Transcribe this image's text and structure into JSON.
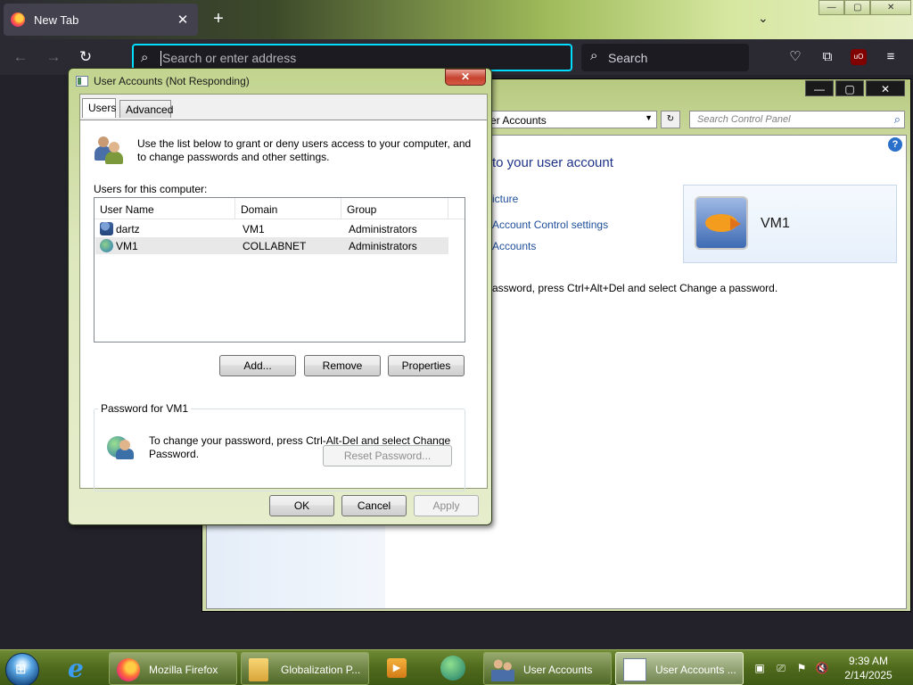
{
  "browser": {
    "tab_title": "New Tab",
    "tab_close": "✕",
    "new_tab": "+",
    "list_tabs": "⌄",
    "url_placeholder": "Search or enter address",
    "search_placeholder": "Search",
    "window_controls": [
      "—",
      "▢",
      "✕"
    ],
    "ublock_label": "uO"
  },
  "control_panel": {
    "address": "er Accounts",
    "search_placeholder": "Search Control Panel",
    "heading": "to your user account",
    "links": [
      "icture",
      "Account Control settings",
      "Accounts"
    ],
    "password_text": "assword, press Ctrl+Alt+Del and select Change a password.",
    "account_name": "VM1",
    "window_controls": [
      "—",
      "▢",
      "✕"
    ],
    "help": "?"
  },
  "dialog": {
    "title": "User Accounts (Not Responding)",
    "close": "✕",
    "tabs": [
      "Users",
      "Advanced"
    ],
    "intro": "Use the list below to grant or deny users access to your computer, and to change passwords and other settings.",
    "users_label": "Users for this computer:",
    "columns": [
      "User Name",
      "Domain",
      "Group"
    ],
    "rows": [
      {
        "name": "dartz",
        "domain": "VM1",
        "group": "Administrators"
      },
      {
        "name": "VM1",
        "domain": "COLLABNET",
        "group": "Administrators"
      }
    ],
    "buttons": {
      "add": "Add...",
      "remove": "Remove",
      "properties": "Properties"
    },
    "password_group": "Password for VM1",
    "password_text": "To change your password, press Ctrl-Alt-Del and select Change Password.",
    "reset_password": "Reset Password...",
    "ok": "OK",
    "cancel": "Cancel",
    "apply": "Apply"
  },
  "taskbar": {
    "tasks": [
      "Mozilla Firefox",
      "Globalization P...",
      "User Accounts",
      "User Accounts ..."
    ],
    "time": "9:39 AM",
    "date": "2/14/2025"
  }
}
